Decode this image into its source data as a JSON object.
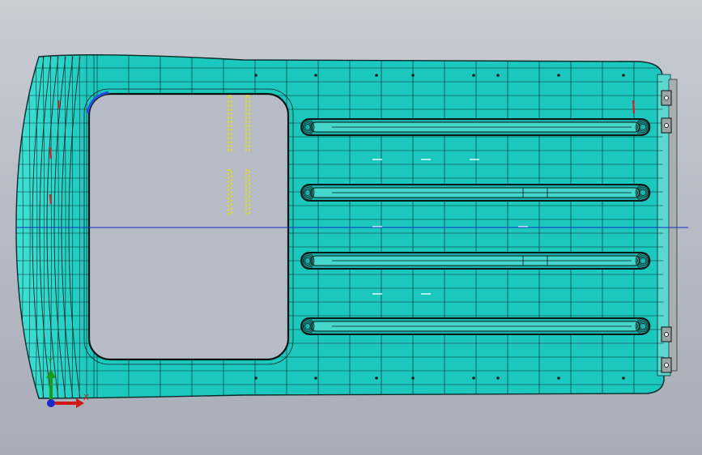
{
  "view": {
    "background_top": "#c9ccd3",
    "background_bottom": "#a8acb7",
    "mesh_fill": "#1cc7bd",
    "mesh_fill_light": "#3fe0d4",
    "mesh_line": "#0a2b2a",
    "opening_fill": "#b7bbc5",
    "centerline_color": "#1530c8",
    "rib_color": "#0c1a1a",
    "marker_yellow": "#e8e000",
    "marker_red": "#d02020",
    "marker_blue": "#2a50e0"
  },
  "triad": {
    "x_label": "X",
    "y_label": "Y",
    "x_color": "#d01818",
    "y_color": "#1a9a1a",
    "origin_color": "#1a2acc",
    "icon": "coordinate-triad-icon"
  }
}
